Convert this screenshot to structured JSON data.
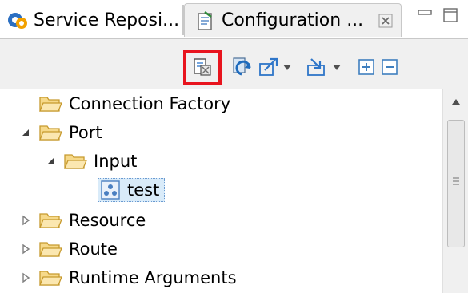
{
  "tabs": [
    {
      "label": "Service Reposi...",
      "icon": "service-repository-icon",
      "active": false
    },
    {
      "label": "Configuration ...",
      "icon": "configuration-icon",
      "active": true
    }
  ],
  "toolbar": {
    "buttons": [
      "filter-properties-icon",
      "refresh-icon",
      "export-icon",
      "import-icon",
      "expand-all-icon",
      "collapse-all-icon"
    ],
    "highlight_color": "#e8141e"
  },
  "tree": {
    "items": [
      {
        "label": "Connection Factory",
        "expanded": null
      },
      {
        "label": "Port",
        "expanded": true
      },
      {
        "label": "Input",
        "expanded": true
      },
      {
        "label": "test",
        "selected": true
      },
      {
        "label": "Resource",
        "expanded": false
      },
      {
        "label": "Route",
        "expanded": false
      },
      {
        "label": "Runtime Arguments",
        "expanded": false
      }
    ]
  },
  "colors": {
    "folder_fill": "#f6d98a",
    "folder_stroke": "#c79a2e",
    "selection_bg": "#d9ebf9",
    "toolbar_bg": "#f0f0f0"
  }
}
